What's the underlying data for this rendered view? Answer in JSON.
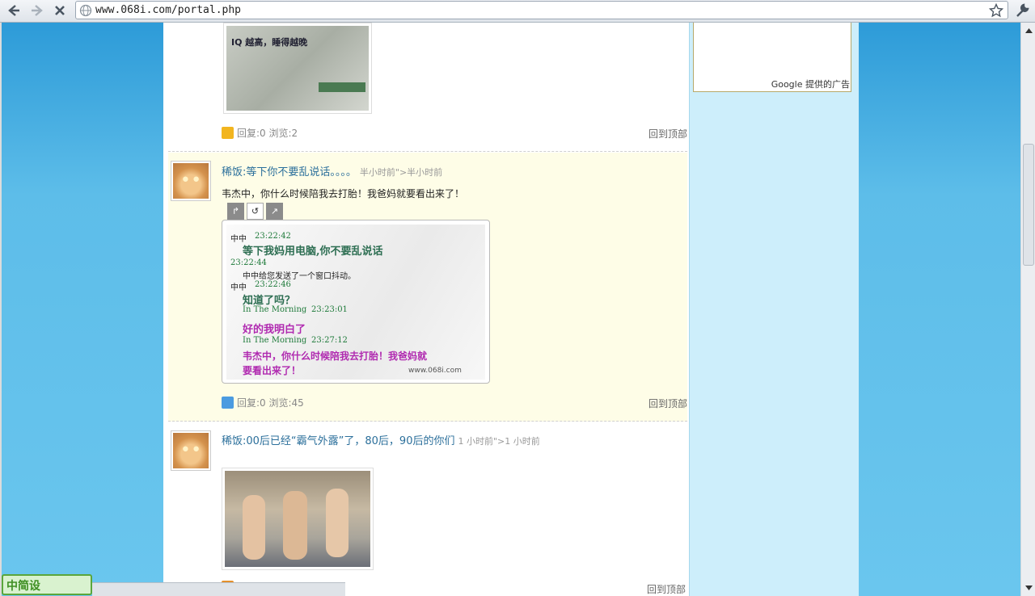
{
  "browser": {
    "url": "www.068i.com/portal.php",
    "back_icon": "back-arrow-icon",
    "forward_icon": "forward-arrow-icon",
    "stop_icon": "stop-icon"
  },
  "sidebar": {
    "ad_label": "Google 提供的广告"
  },
  "posts": [
    {
      "image_text": "IQ 越高，睡得越晚",
      "meta_text": "回复:0 浏览:2",
      "back_to_top": "回到顶部"
    },
    {
      "title": "稀饭:等下你不要乱说话。。。。",
      "time": "半小时前\">半小时前",
      "body": "韦杰中，你什么时候陪我去打胎！我爸妈就要看出来了！",
      "chat": [
        {
          "name": "中中",
          "time": "23:22:42",
          "msg": "等下我妈用电脑,你不要乱说话"
        },
        {
          "time": "23:22:44",
          "sys": "中中给您发送了一个窗口抖动。"
        },
        {
          "name": "中中",
          "time": "23:22:46",
          "msg": "知道了吗？"
        },
        {
          "name": "In The Morning",
          "time": "23:23:01",
          "msg": "好的我明白了"
        },
        {
          "name": "In The Morning",
          "time": "23:27:12",
          "msg": "韦杰中，你什么时候陪我去打胎！我爸妈就",
          "msg2": "要看出来了！"
        }
      ],
      "watermark": "www.068i.com",
      "meta_text": "回复:0 浏览:45",
      "back_to_top": "回到顶部"
    },
    {
      "title": "稀饭:00后已经“霸气外露”了，80后，90后的你们",
      "time": "1 小时前\">1 小时前",
      "back_to_top": "回到顶部"
    }
  ],
  "footer_logo": "中简设"
}
